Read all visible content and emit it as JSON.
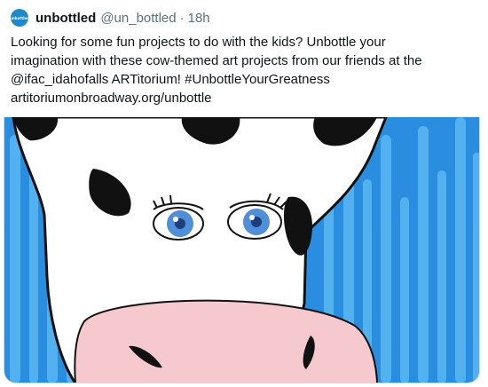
{
  "tweet": {
    "author": {
      "display_name": "unbottled",
      "handle": "@un_bottled",
      "avatar_text": "unbottled",
      "avatar_color": "#1e88c8"
    },
    "separator": "·",
    "time": "18h",
    "text_lines": [
      "Looking for some fun projects to do with the kids? Unbottle your",
      "imagination with these cow-themed art projects from our friends at the",
      "@ifac_idahofalls ARTitorium! #UnbottleYourGreatness",
      "artitoriumonbroadway.org/unbottle"
    ],
    "media": {
      "icon": "cow-painting-image",
      "colors": {
        "background_blue": "#2b8de0",
        "stripe_light": "#5ab8f0",
        "face_white": "#ffffff",
        "nose_pink": "#f6c9cf",
        "eye_blue": "#4f8fd8",
        "spot_black": "#111111"
      }
    }
  }
}
